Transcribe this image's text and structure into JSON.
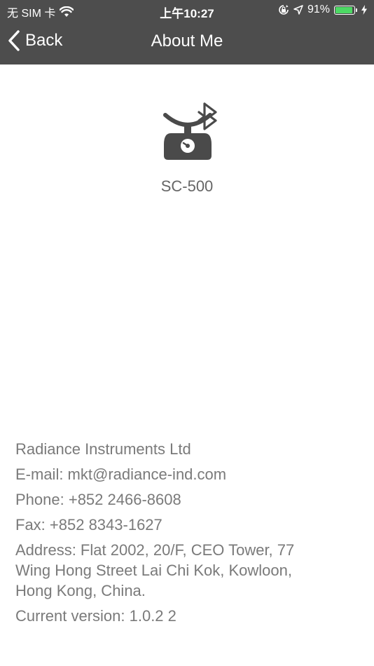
{
  "status_bar": {
    "carrier": "无 SIM 卡",
    "time": "上午10:27",
    "battery_percent": "91%",
    "battery_level": 0.91,
    "battery_color": "#4cd964"
  },
  "nav": {
    "back_label": "Back",
    "title": "About Me"
  },
  "device": {
    "icon": "bluetooth-scale-icon",
    "name": "SC-500"
  },
  "company": {
    "name": "Radiance Instruments Ltd",
    "email": "E-mail:  mkt@radiance-ind.com",
    "phone": "Phone: +852 2466-8608",
    "fax": "Fax: +852 8343-1627",
    "address": "Address:  Flat 2002, 20/F, CEO Tower, 77\nWing Hong Street Lai Chi Kok, Kowloon,\nHong Kong, China.",
    "version": "Current version: 1.0.2 2"
  },
  "colors": {
    "header_bg": "#4d4d4d",
    "text_gray": "#7a7a7a",
    "icon_gray": "#4a4a4a"
  }
}
